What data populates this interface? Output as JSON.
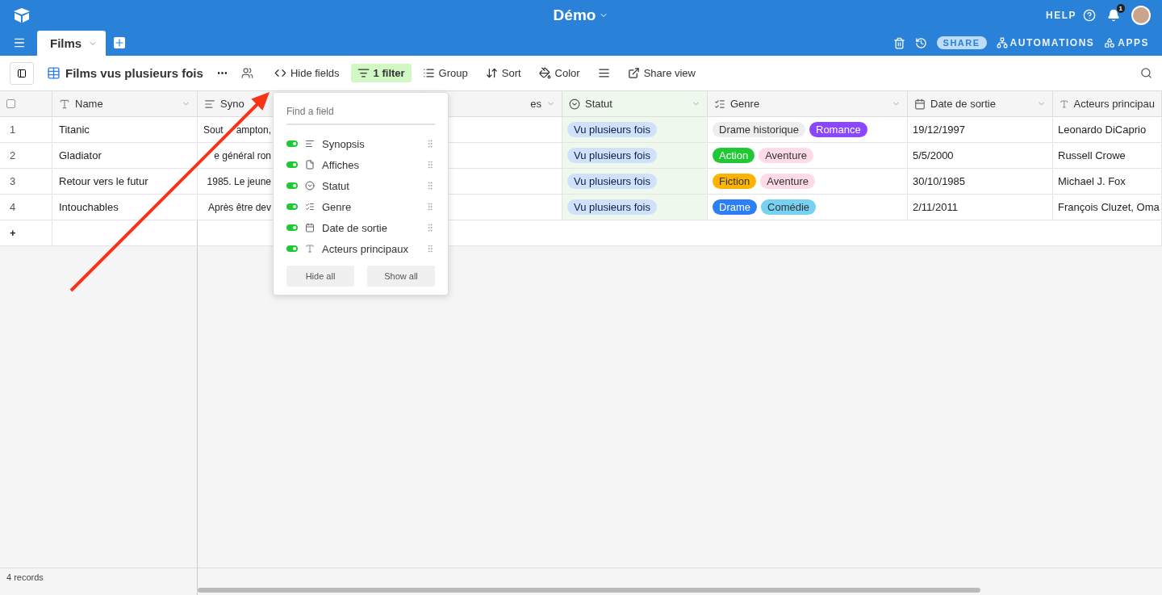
{
  "topbar": {
    "base_title": "Démo",
    "help": "HELP",
    "notifications": "1"
  },
  "tabs": [
    {
      "label": "Films",
      "selected": true
    }
  ],
  "actions": {
    "share": "SHARE",
    "automations": "AUTOMATIONS",
    "apps": "APPS"
  },
  "toolbar": {
    "view_name": "Films vus plusieurs fois",
    "buttons": [
      {
        "kind": "hide",
        "label": "Hide fields",
        "active": false
      },
      {
        "kind": "filter",
        "label": "1 filter",
        "active": true
      },
      {
        "kind": "group",
        "label": "Group",
        "active": false
      },
      {
        "kind": "sort",
        "label": "Sort",
        "active": false
      },
      {
        "kind": "color",
        "label": "Color",
        "active": false
      },
      {
        "kind": "row_height",
        "active": false
      },
      {
        "kind": "share",
        "label": "Share view",
        "active": false
      }
    ]
  },
  "table": {
    "select_all": {
      "checked": false
    },
    "columns": [
      {
        "label": "Name",
        "kind": "text"
      },
      {
        "label": "Syno",
        "kind": "longtext"
      },
      {
        "label": "es",
        "kind": "none"
      },
      {
        "label": "Statut",
        "kind": "select"
      },
      {
        "label": "Genre",
        "kind": "multiselect"
      },
      {
        "label": "Date de sortie",
        "kind": "date"
      },
      {
        "label": "Acteurs principau",
        "kind": "text"
      }
    ],
    "rows": [
      {
        "number": "1",
        "name": "Titanic",
        "synopsis": [
          "Sout",
          "ampton,"
        ],
        "statut": "Vu plusieurs fois",
        "genre": [
          {
            "label": "Drame historique",
            "color": "#eeeeee"
          },
          {
            "label": "Romance",
            "color": "#8b46ff"
          }
        ],
        "date": "19/12/1997",
        "acteurs": "Leonardo DiCaprio"
      },
      {
        "number": "2",
        "name": "Gladiator",
        "synopsis": [
          "e général ron"
        ],
        "statut": "Vu plusieurs fois",
        "genre": [
          {
            "label": "Action",
            "color": "#20c933"
          },
          {
            "label": "Aventure",
            "color": "#ffdce5"
          }
        ],
        "date": "5/5/2000",
        "acteurs": "Russell Crowe"
      },
      {
        "number": "3",
        "name": "Retour vers le futur",
        "synopsis": [
          "1985. Le jeune"
        ],
        "statut": "Vu plusieurs fois",
        "genre": [
          {
            "label": "Fiction",
            "color": "#fcb400"
          },
          {
            "label": "Aventure",
            "color": "#ffdce5"
          }
        ],
        "date": "30/10/1985",
        "acteurs": "Michael J. Fox"
      },
      {
        "number": "4",
        "name": "Intouchables",
        "synopsis": [
          "Après être dev"
        ],
        "statut": "Vu plusieurs fois",
        "genre": [
          {
            "label": "Drame",
            "color": "#2d7ff9"
          },
          {
            "label": "Comédie",
            "color": "#77d1f3"
          }
        ],
        "date": "2/11/2011",
        "acteurs": "François Cluzet, Oma"
      }
    ],
    "add_row": "+"
  },
  "status_bar": {
    "records": "4 records"
  },
  "popup": {
    "placeholder": "Find a field",
    "fields": [
      {
        "label": "Synopsis",
        "kind": "longtext",
        "on": true
      },
      {
        "label": "Affiches",
        "kind": "attachment",
        "on": true
      },
      {
        "label": "Statut",
        "kind": "select",
        "on": true
      },
      {
        "label": "Genre",
        "kind": "multiselect",
        "on": true
      },
      {
        "label": "Date de sortie",
        "kind": "date",
        "on": true
      },
      {
        "label": "Acteurs principaux",
        "kind": "text",
        "on": true
      }
    ],
    "buttons": [
      "Hide all",
      "Show all"
    ]
  }
}
